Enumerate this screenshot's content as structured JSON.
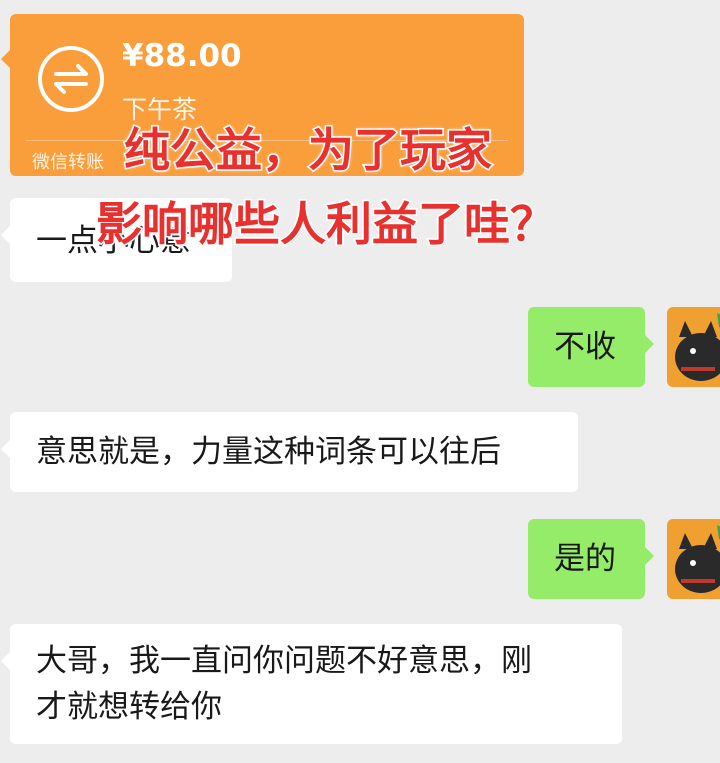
{
  "transfer": {
    "amount": "¥88.00",
    "note": "下午茶",
    "label": "微信转账",
    "icon": "transfer-arrows-icon"
  },
  "messages": [
    {
      "side": "in",
      "text": "一点小心意"
    },
    {
      "side": "out",
      "text": "不收"
    },
    {
      "side": "in",
      "text": "意思就是，力量这种词条可以往后"
    },
    {
      "side": "out",
      "text": "是的"
    },
    {
      "side": "in",
      "line1": "大哥，我一直问你问题不好意思，刚",
      "line2": "才就想转给你"
    }
  ],
  "overlay": {
    "line1": "纯公益，为了玩家",
    "line2": "影响哪些人利益了哇？",
    "color": "#e8302e"
  },
  "colors": {
    "background": "#ededed",
    "incoming_bubble": "#ffffff",
    "outgoing_bubble": "#95ec69",
    "transfer_card": "#fa9d3b"
  }
}
